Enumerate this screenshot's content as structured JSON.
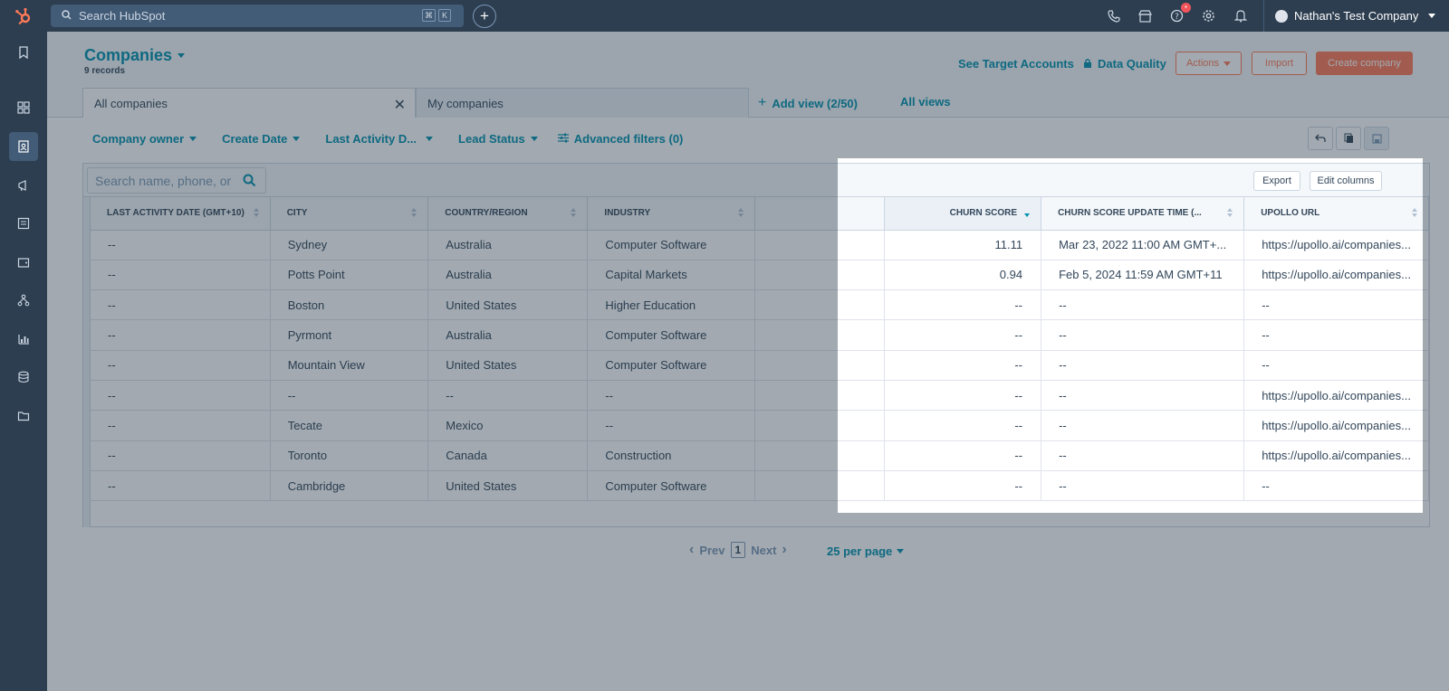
{
  "topbar": {
    "search_placeholder": "Search HubSpot",
    "kbd_cmd": "⌘",
    "kbd_k": "K",
    "plus": "+",
    "notification_count": "•",
    "account_name": "Nathan's Test Company"
  },
  "header": {
    "title": "Companies",
    "records": "9 records",
    "see_target_accounts": "See Target Accounts",
    "data_quality": "Data Quality",
    "actions": "Actions",
    "import": "Import",
    "create_company": "Create company"
  },
  "views": {
    "tab_all": "All companies",
    "tab_mine": "My companies",
    "add_view": "Add view (2/50)",
    "all_views": "All views"
  },
  "filters": {
    "company_owner": "Company owner",
    "create_date": "Create Date",
    "last_activity": "Last Activity D...",
    "lead_status": "Lead Status",
    "advanced": "Advanced filters (0)"
  },
  "table": {
    "search_placeholder": "Search name, phone, or",
    "export": "Export",
    "edit_columns": "Edit columns",
    "columns": [
      "Last Activity Date (GMT+10)",
      "City",
      "Country/Region",
      "Industry",
      "",
      "Churn Score",
      "Churn Score Update Time (...",
      "Upollo URL"
    ],
    "rows": [
      [
        "--",
        "Sydney",
        "Australia",
        "Computer Software",
        "",
        "11.11",
        "Mar 23, 2022 11:00 AM GMT+...",
        "https://upollo.ai/companies..."
      ],
      [
        "--",
        "Potts Point",
        "Australia",
        "Capital Markets",
        "",
        "0.94",
        "Feb 5, 2024 11:59 AM GMT+11",
        "https://upollo.ai/companies..."
      ],
      [
        "--",
        "Boston",
        "United States",
        "Higher Education",
        "",
        "--",
        "--",
        "--"
      ],
      [
        "--",
        "Pyrmont",
        "Australia",
        "Computer Software",
        "",
        "--",
        "--",
        "--"
      ],
      [
        "--",
        "Mountain View",
        "United States",
        "Computer Software",
        "",
        "--",
        "--",
        "--"
      ],
      [
        "--",
        "--",
        "--",
        "--",
        "",
        "--",
        "--",
        "https://upollo.ai/companies..."
      ],
      [
        "--",
        "Tecate",
        "Mexico",
        "--",
        "",
        "--",
        "--",
        "https://upollo.ai/companies..."
      ],
      [
        "--",
        "Toronto",
        "Canada",
        "Construction",
        "",
        "--",
        "--",
        "https://upollo.ai/companies..."
      ],
      [
        "--",
        "Cambridge",
        "United States",
        "Computer Software",
        "",
        "--",
        "--",
        "--"
      ]
    ]
  },
  "pagination": {
    "prev": "Prev",
    "page": "1",
    "next": "Next",
    "per_page": "25 per page"
  },
  "colors": {
    "nav_bg": "#2d3e50",
    "accent_teal": "#0091ae",
    "accent_orange": "#ff7a59"
  }
}
